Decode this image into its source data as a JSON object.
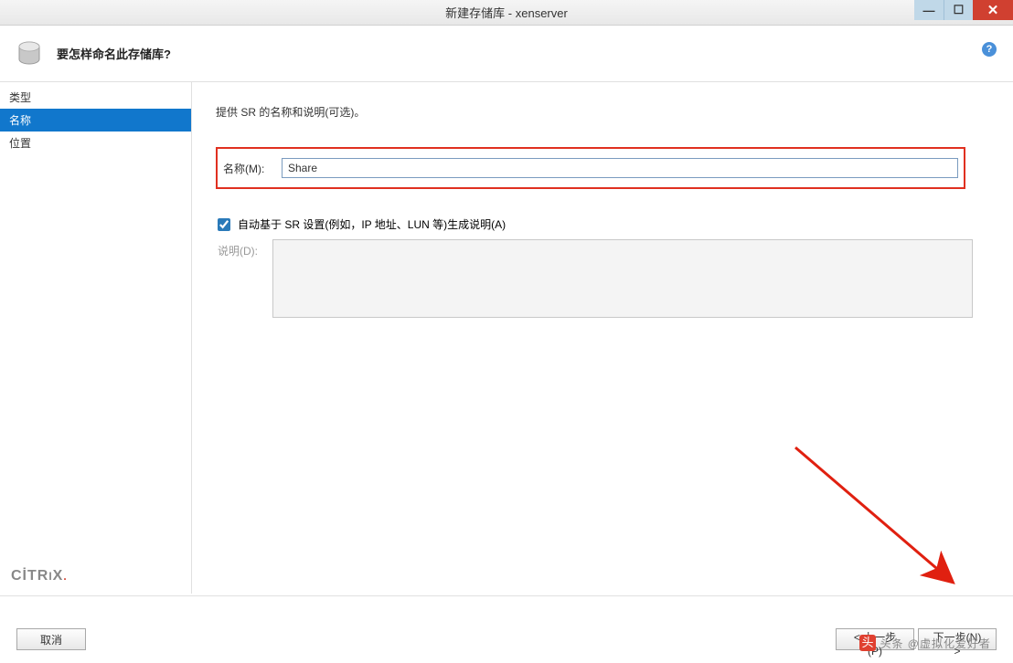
{
  "titlebar": {
    "title": "新建存储库 - xenserver"
  },
  "header": {
    "question": "要怎样命名此存储库?"
  },
  "sidebar": {
    "items": [
      {
        "label": "类型"
      },
      {
        "label": "名称"
      },
      {
        "label": "位置"
      }
    ]
  },
  "main": {
    "desc": "提供 SR 的名称和说明(可选)。",
    "name_label": "名称(M):",
    "name_value": "Share",
    "autogen_label": "自动基于 SR 设置(例如，IP 地址、LUN 等)生成说明(A)",
    "desc_label": "说明(D):"
  },
  "footer": {
    "cancel": "取消",
    "prev": "< 上一步(P)",
    "next": "下一步(N) >"
  },
  "brand": "CİTRIX",
  "watermark": "头条 @虚拟化爱好者"
}
